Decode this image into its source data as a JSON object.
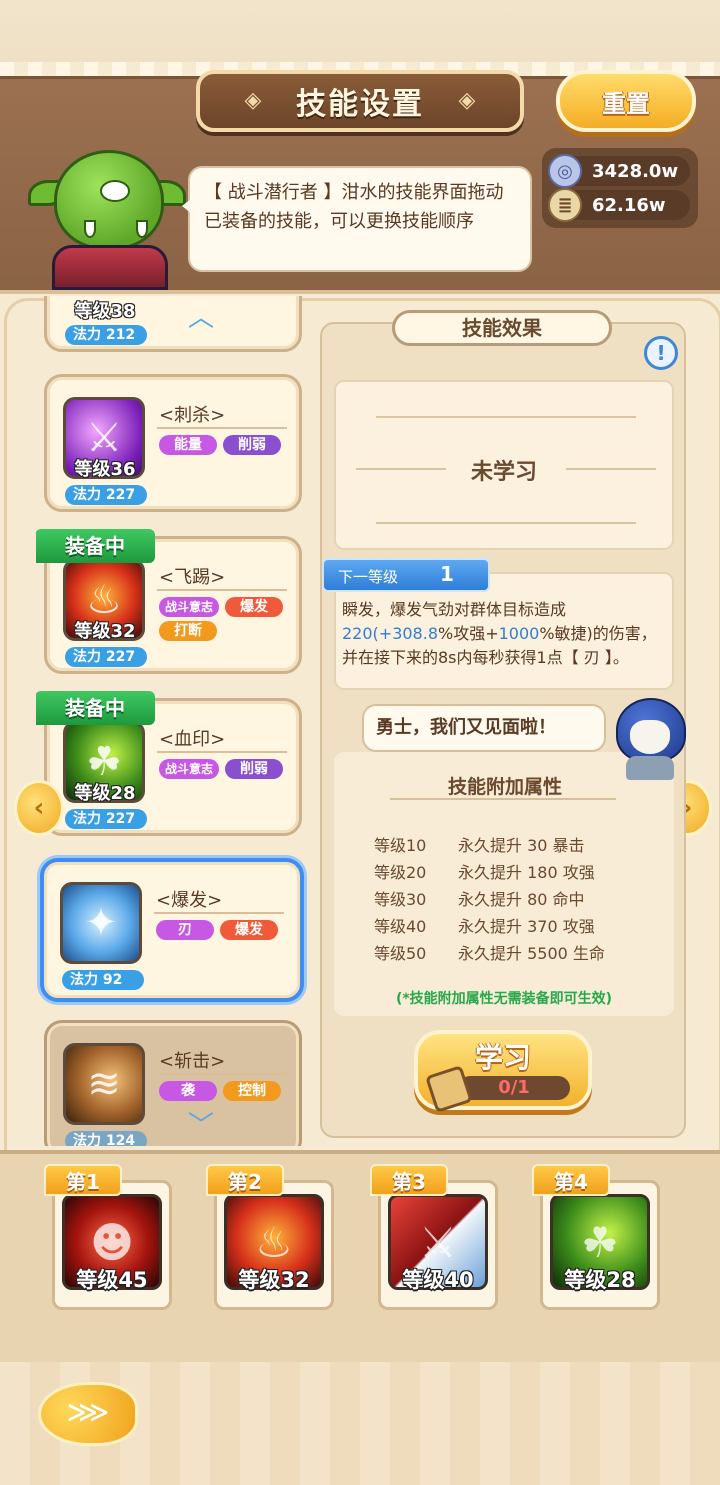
{
  "header": {
    "title": "技能设置",
    "reset_label": "重置"
  },
  "dialog": {
    "text": "【 战斗潜行者 】泔水的技能界面拖动已装备的技能，可以更换技能顺序"
  },
  "resources": [
    {
      "icon": "coin-icon",
      "value": "3428.0w"
    },
    {
      "icon": "scroll-icon",
      "value": "62.16w"
    }
  ],
  "skills": [
    {
      "name": "",
      "level": "等级38",
      "mana": "法力 212",
      "tags": [],
      "equipped": false,
      "icon": "skill-partial-icon"
    },
    {
      "name": "<刺杀>",
      "level": "等级36",
      "mana": "法力 227",
      "tags": [
        {
          "label": "能量",
          "color": "#c758e3"
        },
        {
          "label": "削弱",
          "color": "#8a4fcf"
        }
      ],
      "equipped": false,
      "icon": "assassinate-icon"
    },
    {
      "name": "<飞踢>",
      "level": "等级32",
      "mana": "法力 227",
      "tags": [
        {
          "label": "战斗意志",
          "color": "#c758e3"
        },
        {
          "label": "爆发",
          "color": "#f05a3a"
        },
        {
          "label": "打断",
          "color": "#f29a1e"
        }
      ],
      "equipped": true,
      "icon": "flying-kick-icon"
    },
    {
      "name": "<血印>",
      "level": "等级28",
      "mana": "法力 227",
      "tags": [
        {
          "label": "战斗意志",
          "color": "#c758e3"
        },
        {
          "label": "削弱",
          "color": "#8a4fcf"
        }
      ],
      "equipped": true,
      "icon": "blood-seal-icon"
    },
    {
      "name": "<爆发>",
      "level": "",
      "mana": "法力 92",
      "tags": [
        {
          "label": "刃",
          "color": "#c758e3"
        },
        {
          "label": "爆发",
          "color": "#f05a3a"
        }
      ],
      "equipped": false,
      "icon": "burst-icon",
      "selected": true
    },
    {
      "name": "<斩击>",
      "level": "",
      "mana": "法力 124",
      "tags": [
        {
          "label": "袭",
          "color": "#c758e3"
        },
        {
          "label": "控制",
          "color": "#f29a1e"
        }
      ],
      "equipped": false,
      "icon": "slash-icon",
      "locked": true
    }
  ],
  "equipped_label": "装备中",
  "effect": {
    "title": "技能效果",
    "status": "未学习",
    "next_level_label": "下一等级",
    "next_level_value": "1",
    "desc_1": "瞬发，爆发气劲对群体目标造成",
    "desc_val1": "220(+3",
    "desc_val2": "08.8",
    "desc_2": "%攻强+",
    "desc_val3": "1000",
    "desc_3": "%敏捷)的伤害，并在接下来的8s内每秒获得1点【 刃 】。"
  },
  "hero_speech": "勇士，我们又见面啦！",
  "attributes": {
    "title": "技能附加属性",
    "rows": [
      {
        "level": "等级10",
        "bonus": "永久提升 30 暴击"
      },
      {
        "level": "等级20",
        "bonus": "永久提升 180 攻强"
      },
      {
        "level": "等级30",
        "bonus": "永久提升 80 命中"
      },
      {
        "level": "等级40",
        "bonus": "永久提升 370 攻强"
      },
      {
        "level": "等级50",
        "bonus": "永久提升 5500 生命"
      }
    ],
    "note": "(*技能附加属性无需装备即可生效)"
  },
  "learn": {
    "label": "学习",
    "progress": "0/1"
  },
  "slots": [
    {
      "badge": "第1",
      "level": "等级45",
      "icon": "shadow-demon-icon"
    },
    {
      "badge": "第2",
      "level": "等级32",
      "icon": "flying-kick-icon"
    },
    {
      "badge": "第3",
      "level": "等级40",
      "icon": "blade-icon"
    },
    {
      "badge": "第4",
      "level": "等级28",
      "icon": "blood-seal-icon"
    }
  ],
  "colors": {
    "accent_blue": "#2f7fd6",
    "equip_green": "#1e9a3e",
    "gold": "#f3b12c"
  }
}
